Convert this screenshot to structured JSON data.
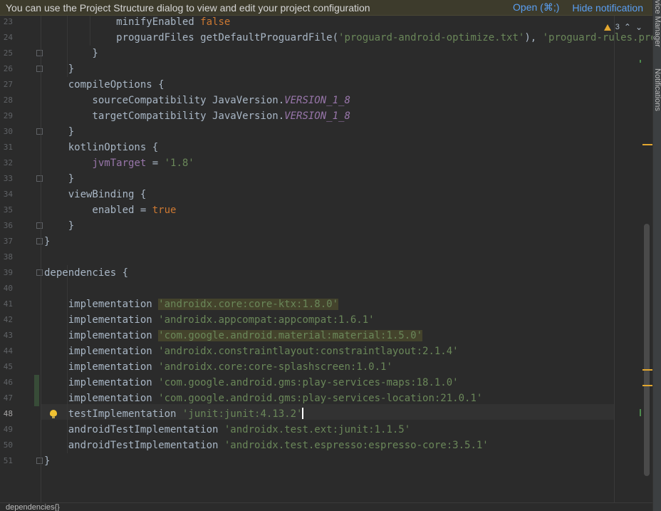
{
  "notification": {
    "message": "You can use the Project Structure dialog to view and edit your project configuration",
    "open_label": "Open (⌘;)",
    "hide_label": "Hide notification"
  },
  "inspection": {
    "warning_count": "3",
    "icon": "warning-icon"
  },
  "tool_windows": {
    "device_manager": "vice Manager",
    "notifications": "Notifications"
  },
  "editor": {
    "current_line": "48",
    "lines": [
      {
        "n": "23",
        "tokens": [
          {
            "t": "            minifyEnabled "
          },
          {
            "t": "false",
            "c": "k"
          }
        ]
      },
      {
        "n": "24",
        "tokens": [
          {
            "t": "            proguardFiles getDefaultProguardFile("
          },
          {
            "t": "'proguard-android-optimize.txt'",
            "c": "s"
          },
          {
            "t": "), "
          },
          {
            "t": "'proguard-rules.pro'",
            "c": "s"
          }
        ]
      },
      {
        "n": "25",
        "tokens": [
          {
            "t": "        }"
          }
        ]
      },
      {
        "n": "26",
        "tokens": [
          {
            "t": "    }"
          }
        ]
      },
      {
        "n": "27",
        "tokens": [
          {
            "t": "    compileOptions {"
          }
        ]
      },
      {
        "n": "28",
        "tokens": [
          {
            "t": "        sourceCompatibility JavaVersion."
          },
          {
            "t": "VERSION_1_8",
            "c": "c"
          }
        ]
      },
      {
        "n": "29",
        "tokens": [
          {
            "t": "        targetCompatibility JavaVersion."
          },
          {
            "t": "VERSION_1_8",
            "c": "c"
          }
        ]
      },
      {
        "n": "30",
        "tokens": [
          {
            "t": "    }"
          }
        ]
      },
      {
        "n": "31",
        "tokens": [
          {
            "t": "    kotlinOptions {"
          }
        ]
      },
      {
        "n": "32",
        "tokens": [
          {
            "t": "        "
          },
          {
            "t": "jvmTarget",
            "c": "p"
          },
          {
            "t": " = "
          },
          {
            "t": "'1.8'",
            "c": "s"
          }
        ]
      },
      {
        "n": "33",
        "tokens": [
          {
            "t": "    }"
          }
        ]
      },
      {
        "n": "34",
        "tokens": [
          {
            "t": "    viewBinding {"
          }
        ]
      },
      {
        "n": "35",
        "tokens": [
          {
            "t": "        enabled = "
          },
          {
            "t": "true",
            "c": "k"
          }
        ]
      },
      {
        "n": "36",
        "tokens": [
          {
            "t": "    }"
          }
        ]
      },
      {
        "n": "37",
        "tokens": [
          {
            "t": "}"
          }
        ]
      },
      {
        "n": "38",
        "tokens": []
      },
      {
        "n": "39",
        "tokens": [
          {
            "t": "dependencies {"
          }
        ]
      },
      {
        "n": "40",
        "tokens": []
      },
      {
        "n": "41",
        "tokens": [
          {
            "t": "    implementation "
          },
          {
            "t": "'androidx.core:core-ktx:1.8.0'",
            "c": "s hl"
          }
        ]
      },
      {
        "n": "42",
        "tokens": [
          {
            "t": "    implementation "
          },
          {
            "t": "'androidx.appcompat:appcompat:1.6.1'",
            "c": "s"
          }
        ]
      },
      {
        "n": "43",
        "tokens": [
          {
            "t": "    implementation "
          },
          {
            "t": "'com.google.android.material:material:1.5.0'",
            "c": "s hl"
          }
        ]
      },
      {
        "n": "44",
        "tokens": [
          {
            "t": "    implementation "
          },
          {
            "t": "'androidx.constraintlayout:constraintlayout:2.1.4'",
            "c": "s"
          }
        ]
      },
      {
        "n": "45",
        "tokens": [
          {
            "t": "    implementation "
          },
          {
            "t": "'androidx.core:core-splashscreen:1.0.1'",
            "c": "s"
          }
        ]
      },
      {
        "n": "46",
        "tokens": [
          {
            "t": "    implementation "
          },
          {
            "t": "'com.google.android.gms:play-services-maps:18.1.0'",
            "c": "s"
          }
        ]
      },
      {
        "n": "47",
        "tokens": [
          {
            "t": "    implementation "
          },
          {
            "t": "'com.google.android.gms:play-services-location:21.0.1'",
            "c": "s"
          }
        ]
      },
      {
        "n": "48",
        "tokens": [
          {
            "t": "    testImplementation "
          },
          {
            "t": "'junit:junit:4.13.2'",
            "c": "s"
          }
        ]
      },
      {
        "n": "49",
        "tokens": [
          {
            "t": "    androidTestImplementation "
          },
          {
            "t": "'androidx.test.ext:junit:1.1.5'",
            "c": "s"
          }
        ]
      },
      {
        "n": "50",
        "tokens": [
          {
            "t": "    androidTestImplementation "
          },
          {
            "t": "'androidx.test.espresso:espresso-core:3.5.1'",
            "c": "s"
          }
        ]
      },
      {
        "n": "51",
        "tokens": [
          {
            "t": "}"
          }
        ]
      }
    ]
  },
  "breadcrumb": "dependencies{}"
}
